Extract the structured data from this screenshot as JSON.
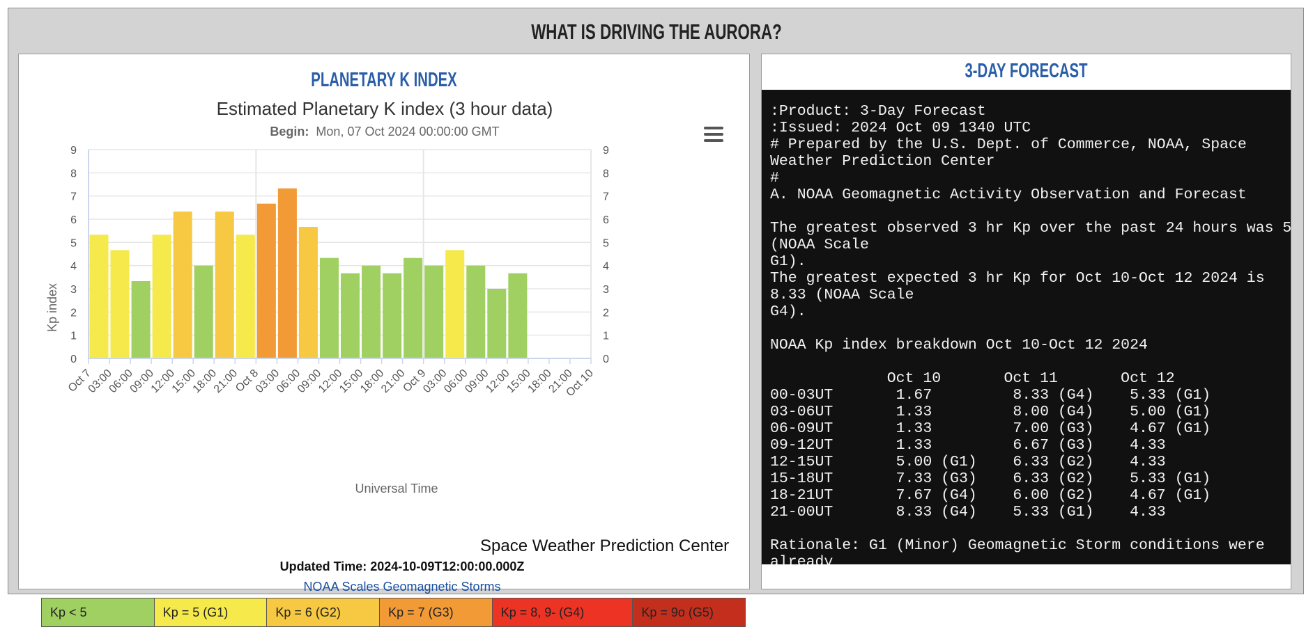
{
  "page_title": "WHAT IS DRIVING THE AURORA?",
  "left_panel": {
    "title": "PLANETARY K INDEX",
    "updated": "Updated Time: 2024-10-09T12:00:00.000Z",
    "noaa_link": "NOAA Scales Geomagnetic Storms",
    "credit": "Space Weather Prediction Center",
    "menu_icon": "hamburger-menu-icon"
  },
  "legend": [
    {
      "label": "Kp < 5",
      "color": "#a0d062"
    },
    {
      "label": "Kp = 5 (G1)",
      "color": "#f5e94c"
    },
    {
      "label": "Kp = 6 (G2)",
      "color": "#f7c842"
    },
    {
      "label": "Kp = 7 (G3)",
      "color": "#f29b36"
    },
    {
      "label": "Kp = 8, 9- (G4)",
      "color": "#ec3324"
    },
    {
      "label": "Kp = 9o (G5)",
      "color": "#c42e1c"
    }
  ],
  "chart_data": {
    "type": "bar",
    "title": "Estimated Planetary K index (3 hour data)",
    "subtitle_label": "Begin:",
    "subtitle_value": "Mon, 07 Oct 2024 00:00:00 GMT",
    "xlabel": "Universal Time",
    "ylabel": "Kp index",
    "ylim": [
      0,
      9
    ],
    "yticks": [
      "0",
      "1",
      "2",
      "3",
      "4",
      "5",
      "6",
      "7",
      "8",
      "9"
    ],
    "x_ticks": [
      "Oct 7",
      "03:00",
      "06:00",
      "09:00",
      "12:00",
      "15:00",
      "18:00",
      "21:00",
      "Oct 8",
      "03:00",
      "06:00",
      "09:00",
      "12:00",
      "15:00",
      "18:00",
      "21:00",
      "Oct 9",
      "03:00",
      "06:00",
      "09:00",
      "12:00",
      "15:00",
      "18:00",
      "21:00",
      "Oct 10"
    ],
    "values": [
      5.33,
      4.67,
      3.33,
      5.33,
      6.33,
      4.0,
      6.33,
      5.33,
      6.67,
      7.33,
      5.67,
      4.33,
      3.67,
      4.0,
      3.67,
      4.33,
      4.0,
      4.67,
      4.0,
      3.0,
      3.67
    ],
    "colors": [
      "#f5e94c",
      "#f5e94c",
      "#a0d062",
      "#f5e94c",
      "#f7c842",
      "#a0d062",
      "#f7c842",
      "#f5e94c",
      "#f29b36",
      "#f29b36",
      "#f7c842",
      "#a0d062",
      "#a0d062",
      "#a0d062",
      "#a0d062",
      "#a0d062",
      "#a0d062",
      "#f5e94c",
      "#a0d062",
      "#a0d062",
      "#a0d062"
    ],
    "grid": true
  },
  "right_panel": {
    "title": "3-DAY FORECAST",
    "text": ":Product: 3-Day Forecast\n:Issued: 2024 Oct 09 1340 UTC\n# Prepared by the U.S. Dept. of Commerce, NOAA, Space\nWeather Prediction Center\n#\nA. NOAA Geomagnetic Activity Observation and Forecast\n\nThe greatest observed 3 hr Kp over the past 24 hours was 5\n(NOAA Scale\nG1).\nThe greatest expected 3 hr Kp for Oct 10-Oct 12 2024 is\n8.33 (NOAA Scale\nG4).\n\nNOAA Kp index breakdown Oct 10-Oct 12 2024\n\n             Oct 10       Oct 11       Oct 12\n00-03UT       1.67         8.33 (G4)    5.33 (G1)\n03-06UT       1.33         8.00 (G4)    5.00 (G1)\n06-09UT       1.33         7.00 (G3)    4.67 (G1)\n09-12UT       1.33         6.67 (G3)    4.33\n12-15UT       5.00 (G1)    6.33 (G2)    4.33\n15-18UT       7.33 (G3)    6.33 (G2)    5.33 (G1)\n18-21UT       7.67 (G4)    6.00 (G2)    4.67 (G1)\n21-00UT       8.33 (G4)    5.33 (G1)    4.33\n\nRationale: G1 (Minor) Geomagnetic Storm conditions were\nalready"
  }
}
